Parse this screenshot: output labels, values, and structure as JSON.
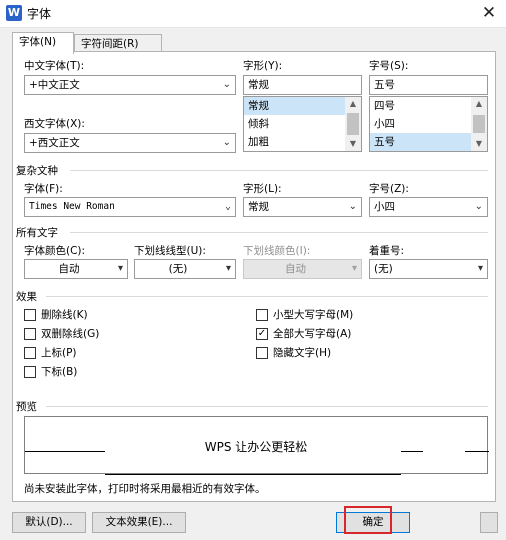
{
  "window": {
    "title": "字体",
    "app_icon_letter": "W",
    "close_glyph": "✕"
  },
  "tabs": [
    {
      "label": "字体(N)"
    },
    {
      "label": "字符间距(R)"
    }
  ],
  "chinese_font": {
    "label": "中文字体(T):",
    "value": "+中文正文"
  },
  "western_font": {
    "label": "西文字体(X):",
    "value": "+西文正文"
  },
  "style": {
    "label": "字形(Y):",
    "value": "常规",
    "items": [
      "常规",
      "倾斜",
      "加粗"
    ],
    "selected_index": 0
  },
  "size": {
    "label": "字号(S):",
    "value": "五号",
    "items": [
      "四号",
      "小四",
      "五号"
    ],
    "selected_index": 2
  },
  "complex": {
    "section_title": "复杂文种",
    "font_label": "字体(F):",
    "font_value": "Times New Roman",
    "style_label": "字形(L):",
    "style_value": "常规",
    "size_label": "字号(Z):",
    "size_value": "小四"
  },
  "all_text": {
    "section_title": "所有文字",
    "color_label": "字体颜色(C):",
    "color_value": "自动",
    "underline_label": "下划线线型(U):",
    "underline_value": "(无)",
    "underline_color_label": "下划线颜色(I):",
    "underline_color_value": "自动",
    "emphasis_label": "着重号:",
    "emphasis_value": "(无)"
  },
  "effects": {
    "section_title": "效果",
    "items": [
      {
        "label": "删除线(K)",
        "checked": false
      },
      {
        "label": "双删除线(G)",
        "checked": false
      },
      {
        "label": "上标(P)",
        "checked": false
      },
      {
        "label": "下标(B)",
        "checked": false
      },
      {
        "label": "小型大写字母(M)",
        "checked": false
      },
      {
        "label": "全部大写字母(A)",
        "checked": true
      },
      {
        "label": "隐藏文字(H)",
        "checked": false
      }
    ]
  },
  "preview": {
    "section_title": "预览",
    "sample_text": "WPS 让办公更轻松",
    "note": "尚未安装此字体，打印时将采用最相近的有效字体。"
  },
  "buttons": {
    "default": "默认(D)...",
    "text_effects": "文本效果(E)...",
    "ok": "确定"
  },
  "icons": {
    "dropdown": "chevron-down-icon",
    "close": "close-icon",
    "check": "checkmark-icon"
  },
  "colors": {
    "accent": "#0078d7",
    "selection": "#cce4f7",
    "highlight_box": "#d9262c",
    "app_icon": "#2b62c9"
  }
}
